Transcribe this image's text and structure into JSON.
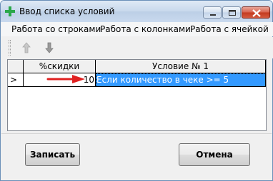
{
  "window": {
    "title": "Ввод списка условий"
  },
  "menu": {
    "items": [
      "Работа со строками",
      "Работа с колонками",
      "Работа с ячейкой"
    ]
  },
  "toolbar": {
    "up_icon": "arrow-up-icon",
    "down_icon": "arrow-down-icon"
  },
  "grid": {
    "columns": [
      "%скидки",
      "Условие № 1"
    ],
    "rows": [
      {
        "indicator": ">",
        "cells": [
          "10",
          "Если количество в чеке >= 5"
        ]
      }
    ],
    "selected_cell_color": "#3399ff"
  },
  "annotation": {
    "arrow_color": "#e02020"
  },
  "buttons": {
    "save_label": "Записать",
    "cancel_label": "Отмена"
  }
}
